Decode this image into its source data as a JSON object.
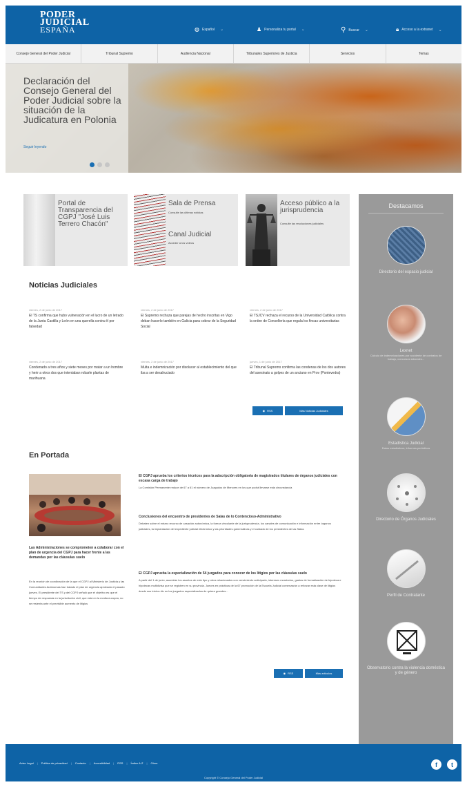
{
  "header": {
    "logo_line1": "PODER",
    "logo_line2": "JUDICIAL",
    "logo_line3": "ESPAÑA",
    "nav": [
      {
        "icon": "globe-icon",
        "label": "Español"
      },
      {
        "icon": "user-icon",
        "label": "Personaliza tu portal"
      },
      {
        "icon": "search-icon",
        "label": "Buscar"
      },
      {
        "icon": "lock-icon",
        "label": "Acceso a la extranet"
      }
    ],
    "color": "#0e63a6"
  },
  "mainnav": {
    "items": [
      "Consejo General del Poder Judicial",
      "Tribunal Supremo",
      "Audiencia Nacional",
      "Tribunales Superiores de Justicia",
      "Servicios",
      "Temas"
    ]
  },
  "hero": {
    "title": "Declaración del Consejo General del Poder Judicial sobre la situación de la Judicatura en Polonia",
    "link": "Seguir leyendo"
  },
  "cards": [
    {
      "title": "Portal de Transparencia del CGPJ \"José Luis Terrero Chacón\"",
      "subtitle": ""
    },
    {
      "title": "Sala de Prensa",
      "subtitle": "Consulte las últimas noticias",
      "title2": "Canal Judicial",
      "subtitle2": "Acceder a los vídeos"
    },
    {
      "title": "Acceso público a la jurisprudencia",
      "subtitle": "Consulte las resoluciones judiciales"
    }
  ],
  "noticias": {
    "title": "Noticias Judiciales",
    "items": [
      {
        "date": "viernes, 2 de junio de 2017",
        "text": "El TS confirma que hubo vulneración en el lucro de un letrado de la Junta Castilla y León en una querella contra él por falsedad"
      },
      {
        "date": "viernes, 2 de junio de 2017",
        "text": "El Supremo rechaza que parejas de hecho inscritas en Vigo deban hacerlo también en Galicia para cobrar de la Seguridad Social"
      },
      {
        "date": "viernes, 2 de junio de 2017",
        "text": "El TSJCV rechaza el recurso de la Universidad Católica contra la orden de Consellería que regula los fincas universitarias"
      },
      {
        "date": "viernes, 2 de junio de 2017",
        "text": "Condenado a tres años y siete meses por matar a un hombre y herir a otros dos que intentaban robarle plantas de marihuana"
      },
      {
        "date": "viernes, 2 de junio de 2017",
        "text": "Multa e indemnización por disolucer al establecimiento del que iba a ser desahuciado"
      },
      {
        "date": "jueves, 1 de junio de 2017",
        "text": "El Tribunal Supremo confirma las condenas de los dos autores del asesinato a golpes de un anciano en Prov (Pontevedra)"
      }
    ],
    "rss": "RSS",
    "more": "Más Noticias Judiciales"
  },
  "portada": {
    "title": "En Portada",
    "lead_title": "Las Administraciones se comprometen a colaborar con el plan de urgencia del CGPJ para hacer frente a las demandas por las cláusulas suelo",
    "lead_text": "En la reunión de coordinación de la que el CGPJ al Ministerio de Justicia y las Comunidades Autónomas han tratado el plan de urgencia aprobado el pasado jueves. El presidente del TS y del CGPJ señaló que el objetivo es que el tiempo de respuesta en la jurisdicción civil, que está en la media europea, no se resienta ante el previsible aumento de litigios",
    "articles": [
      {
        "title": "El CGPJ aprueba los criterios técnicos para la adscripción obligatoria de magistrados titulares de órganos judiciales con escasa carga de trabajo",
        "body": "La Comisión Permanente reduce de 67 a 61 el número de Juzgados de Menores en los que podrá llevarse esta circunstancia"
      },
      {
        "title": "Conclusiones del encuentro de presidentes de Salas de lo Contencioso-Administrativo",
        "body": "Debaten sobre el mismo recurso de casación autonómica, la fuerza vinculante de la jurisprudencia, los canales de comunicación e información entre órganos judiciales, la implantación del expediente judicial electrónico y las prioridades gubernativas y el cuidado de los presidentes de las Salas"
      },
      {
        "title": "El CGPJ aprueba la especialización de 54 juzgados para conocer de los litigios por las cláusulas suelo",
        "body": "A partir del 1 de junio, asumirán los asuntos de este tipo y otros relacionados con vencimiento anticipado, intereses moratorios, gastos de formalización de hipoteca e hipotecas multidivisa que se registren en su provincia. Jueces en prácticas de la 67 promoción de la Escuela Judicial comenzarán a reforzar esta clase de litigios desde sus inicios dic en los juzgados especializados de quiera grandes..."
      }
    ],
    "rss": "RSS",
    "more": "Más artículos"
  },
  "sidebar": {
    "title": "Destacamos",
    "items": [
      {
        "label": "Directorio del espacio judicial",
        "sub": ""
      },
      {
        "label": "Lexnet",
        "sub": "Cálculo de indemnizaciones por accidente de contratos de trabajo, concursos laborales..."
      },
      {
        "label": "Estadística Judicial",
        "sub": "Datos estadísticos, informes periódicos"
      },
      {
        "label": "Directorio de Órganos Judiciales",
        "sub": ""
      },
      {
        "label": "Perfil de Contratante",
        "sub": ""
      },
      {
        "label": "Observatorio contra la violencia doméstica y de género",
        "sub": ""
      }
    ],
    "bg_color": "#9a9a9a"
  },
  "footer": {
    "links": [
      "Aviso Legal",
      "Política de privacidad",
      "Contacto",
      "Accesibilidad",
      "RSS",
      "Índice A-Z",
      "Otros"
    ],
    "copyright": "Copyright © Consejo General del Poder Judicial",
    "social": [
      {
        "icon": "facebook-icon",
        "text": "f"
      },
      {
        "icon": "twitter-icon",
        "text": "t"
      }
    ]
  }
}
